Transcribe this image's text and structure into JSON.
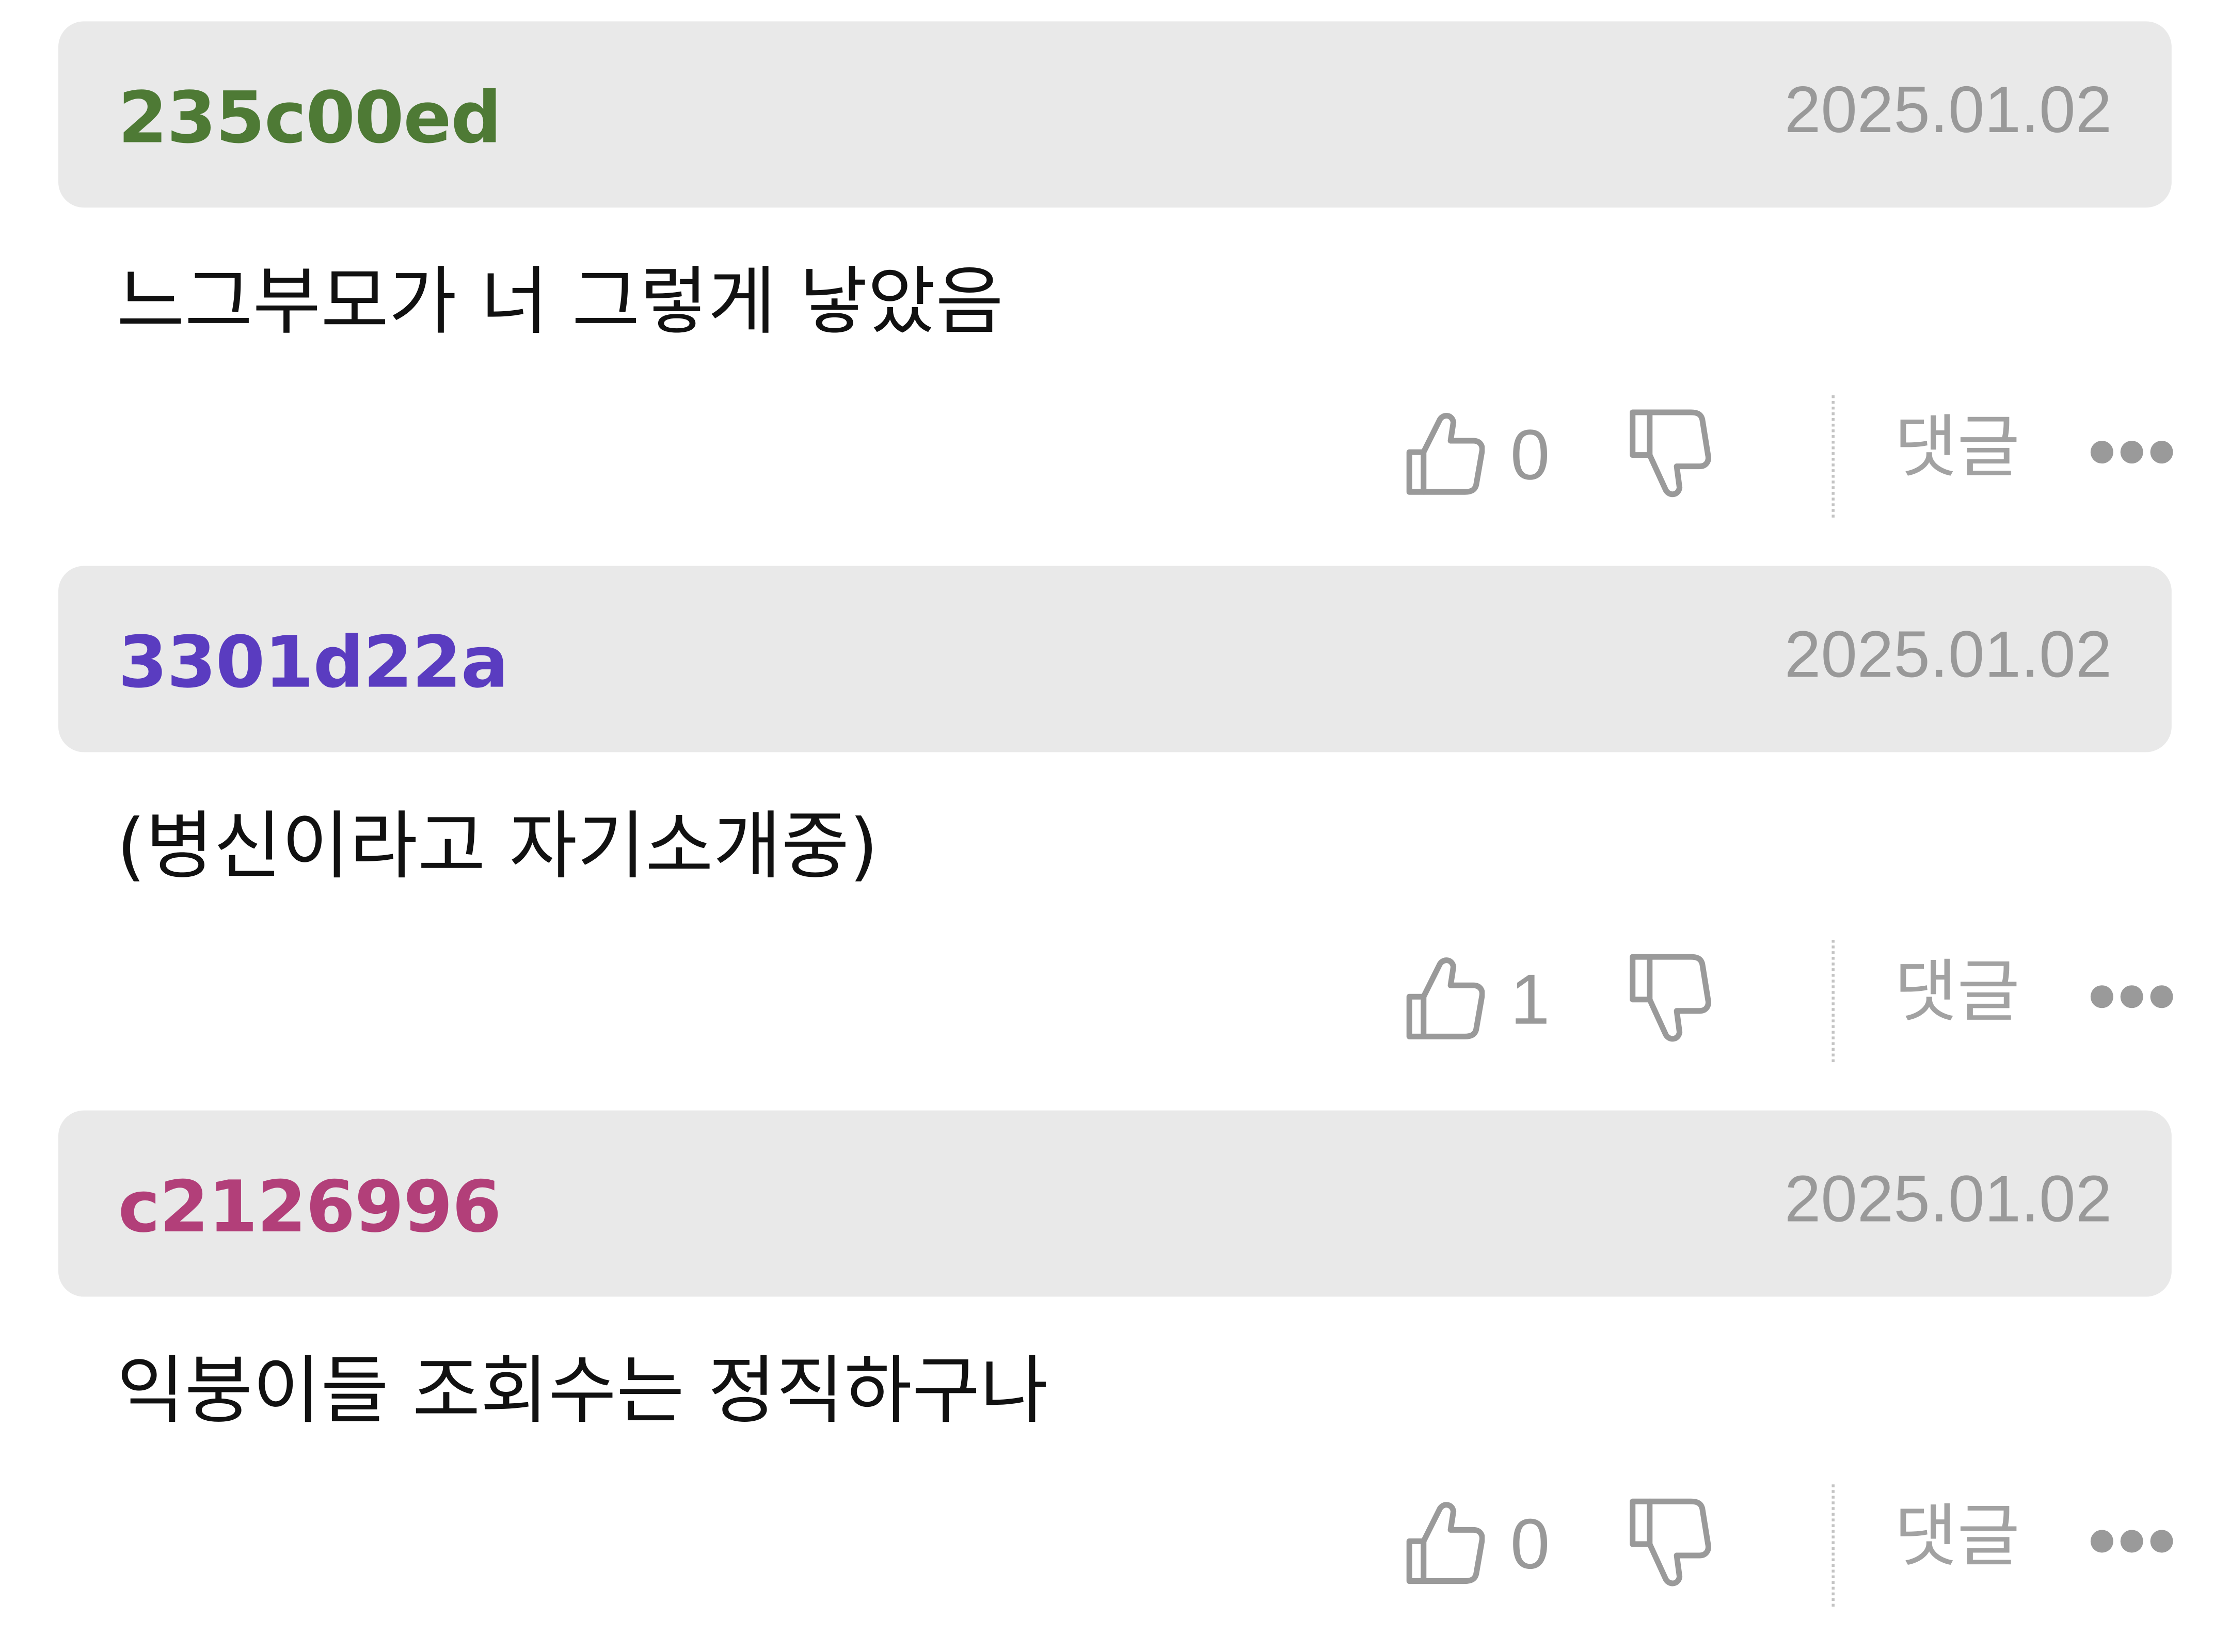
{
  "comments": [
    {
      "username": "235c00ed",
      "username_color": "#4e7a35",
      "date": "2025.01.02",
      "body": "느그부모가 너 그렇게 낳았음",
      "likes": "0",
      "reply_label": "댓글"
    },
    {
      "username": "3301d22a",
      "username_color": "#5a3cc0",
      "date": "2025.01.02",
      "body": "(병신이라고 자기소개중)",
      "likes": "1",
      "reply_label": "댓글"
    },
    {
      "username": "c2126996",
      "username_color": "#b23f79",
      "date": "2025.01.02",
      "body": "익붕이들 조회수는 정직하구나",
      "likes": "0",
      "reply_label": "댓글"
    }
  ],
  "icons": {
    "like": "thumbs-up-icon",
    "dislike": "thumbs-down-icon",
    "more": "more-dots-icon"
  }
}
